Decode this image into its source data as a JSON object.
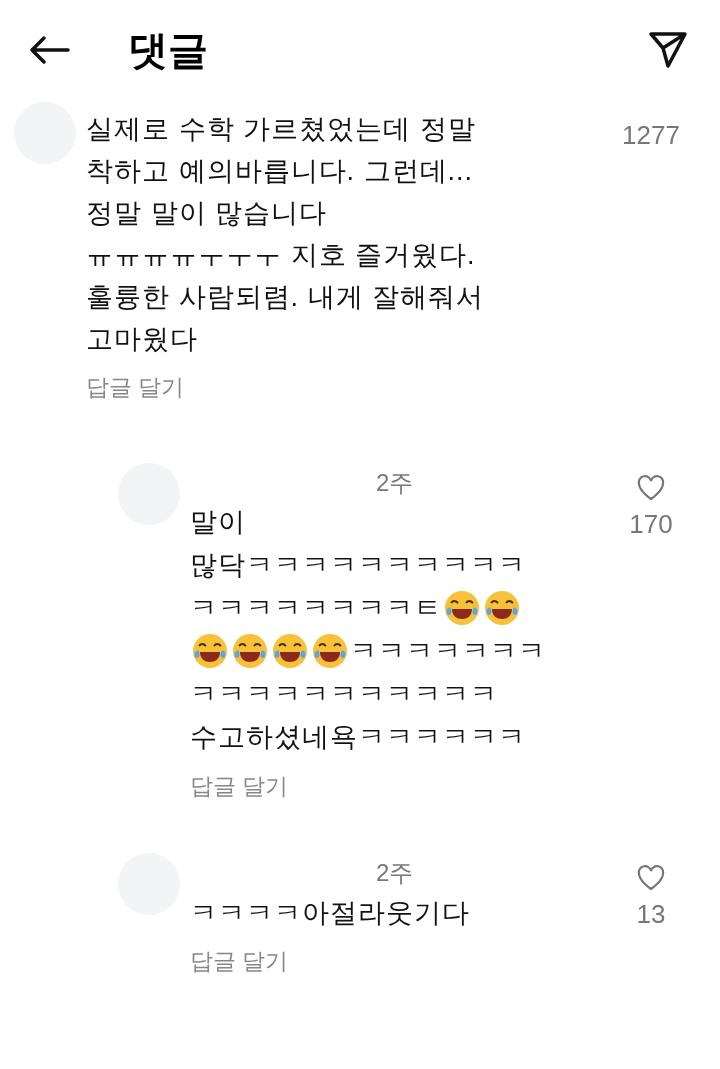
{
  "header": {
    "title": "댓글"
  },
  "comments": [
    {
      "kind": "comment",
      "likes": "1277",
      "lines": [
        [
          {
            "kind": "text",
            "text": "실제로 수학 가르쳤었는데 정말\n착하고 예의바릅니다. 그런데...\n정말 말이 많습니다\nㅠㅠㅠㅠㅜㅜㅜ 지호 즐거웠다.\n훌륭한 사람되렴. 내게 잘해줘서\n고마웠다"
          }
        ]
      ],
      "reply_link": "답글 달기"
    },
    {
      "kind": "reply",
      "time": "2주",
      "likes": "170",
      "lines": [
        [
          {
            "kind": "text",
            "text": "말이"
          }
        ],
        [
          {
            "kind": "text",
            "text": "많닥ㅋㅋㅋㅋㅋㅋㅋㅋㅋㅋ"
          }
        ],
        [
          {
            "kind": "text",
            "text": "ㅋㅋㅋㅋㅋㅋㅋㅋㅌ"
          },
          {
            "kind": "emoji"
          },
          {
            "kind": "emoji"
          }
        ],
        [
          {
            "kind": "emoji"
          },
          {
            "kind": "emoji"
          },
          {
            "kind": "emoji"
          },
          {
            "kind": "emoji"
          },
          {
            "kind": "text",
            "text": "ㅋㅋㅋㅋㅋㅋㅋ"
          }
        ],
        [
          {
            "kind": "text",
            "text": "ㅋㅋㅋㅋㅋㅋㅋㅋㅋㅋㅋ"
          }
        ],
        [
          {
            "kind": "text",
            "text": "수고하셨네욕ㅋㅋㅋㅋㅋㅋ"
          }
        ]
      ],
      "reply_link": "답글 달기"
    },
    {
      "kind": "reply",
      "time": "2주",
      "likes": "13",
      "lines": [
        [
          {
            "kind": "text",
            "text": "ㅋㅋㅋㅋ아절라웃기다"
          }
        ]
      ],
      "reply_link": "답글 달기"
    }
  ]
}
